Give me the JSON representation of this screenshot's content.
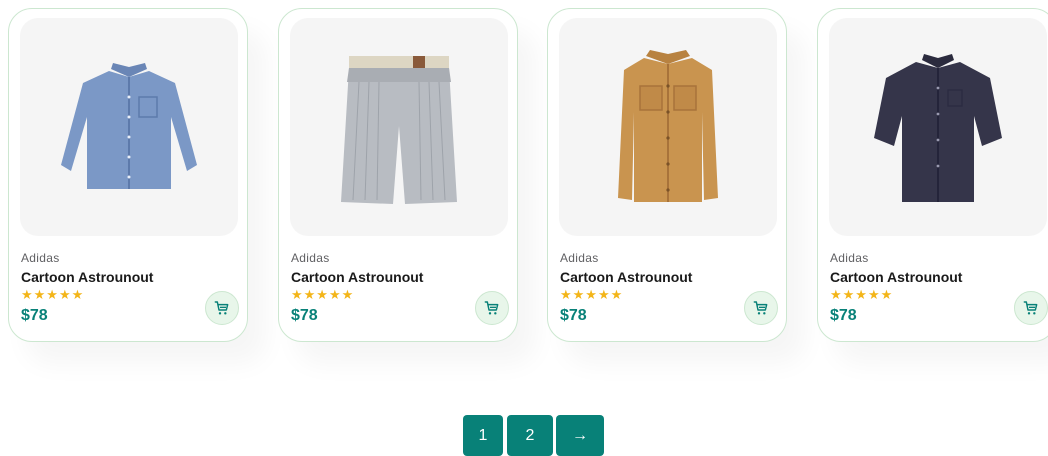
{
  "products": [
    {
      "brand": "Adidas",
      "name": "Cartoon Astrounout",
      "rating": 5,
      "stars": "★★★★★",
      "price": "$78",
      "image": "blue-long-sleeve-shirt"
    },
    {
      "brand": "Adidas",
      "name": "Cartoon Astrounout",
      "rating": 5,
      "stars": "★★★★★",
      "price": "$78",
      "image": "grey-striped-shorts"
    },
    {
      "brand": "Adidas",
      "name": "Cartoon Astrounout",
      "rating": 5,
      "stars": "★★★★★",
      "price": "$78",
      "image": "tan-overshirt"
    },
    {
      "brand": "Adidas",
      "name": "Cartoon Astrounout",
      "rating": 5,
      "stars": "★★★★★",
      "price": "$78",
      "image": "navy-short-sleeve-shirt"
    }
  ],
  "pagination": {
    "page1": "1",
    "page2": "2",
    "next": "→"
  },
  "colors": {
    "accent": "#088178",
    "star": "#f3b519",
    "cart_bg": "#e8f6ea",
    "card_border": "#cce7d0"
  }
}
